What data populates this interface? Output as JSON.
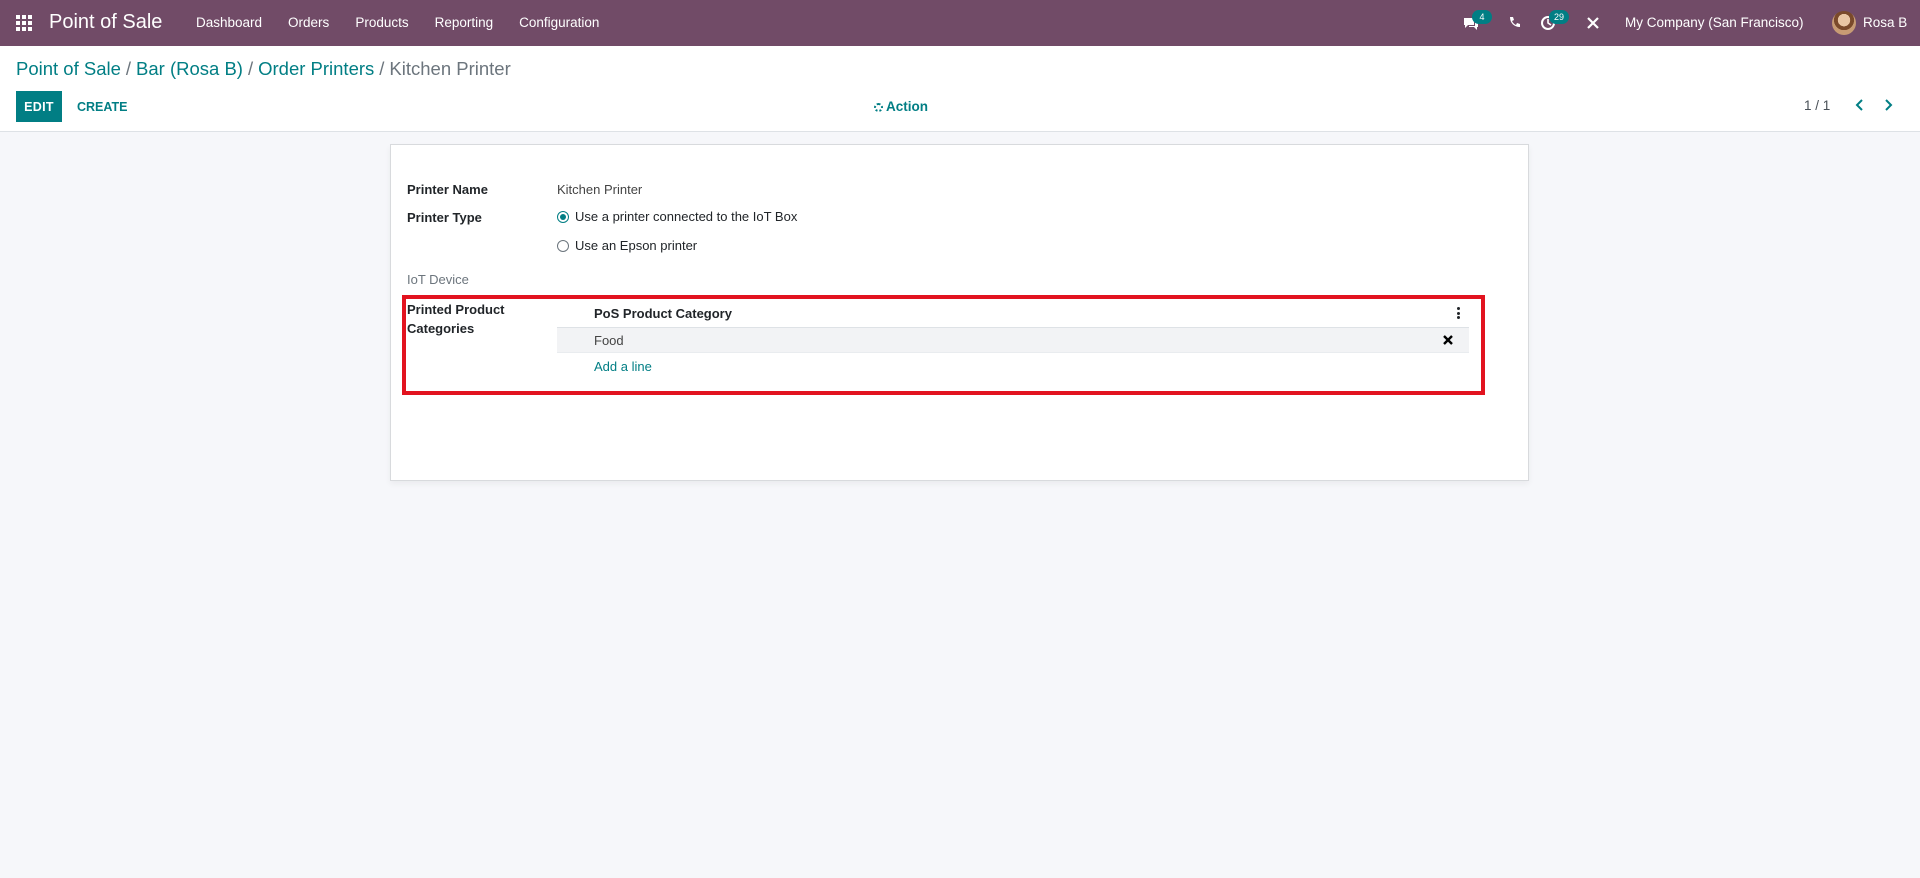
{
  "app": {
    "title": "Point of Sale"
  },
  "menu": [
    "Dashboard",
    "Orders",
    "Products",
    "Reporting",
    "Configuration"
  ],
  "systray": {
    "messages_count": "4",
    "activities_count": "29",
    "company": "My Company (San Francisco)",
    "user": "Rosa B"
  },
  "breadcrumb": {
    "items": [
      "Point of Sale",
      "Bar (Rosa B)",
      "Order Printers"
    ],
    "current": "Kitchen Printer",
    "separator": "/"
  },
  "toolbar": {
    "edit_label": "EDIT",
    "create_label": "CREATE",
    "action_label": "Action"
  },
  "pager": {
    "text": "1 / 1"
  },
  "form": {
    "printer_name_label": "Printer Name",
    "printer_name_value": "Kitchen Printer",
    "printer_type_label": "Printer Type",
    "printer_type_options": [
      "Use a printer connected to the IoT Box",
      "Use an Epson printer"
    ],
    "printer_type_selected": 0,
    "iot_device_label": "IoT Device",
    "categories_label_line1": "Printed Product",
    "categories_label_line2": "Categories",
    "categories_column": "PoS Product Category",
    "categories": [
      "Food"
    ],
    "add_line_label": "Add a line"
  },
  "colors": {
    "navbar": "#714b67",
    "accent": "#017e84",
    "highlight": "#e2131f"
  }
}
